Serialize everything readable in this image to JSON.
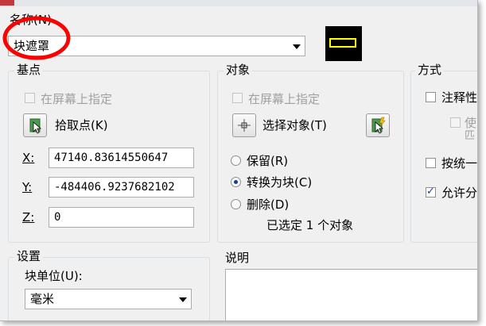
{
  "name_section": {
    "label": "名称(N)",
    "value": "块遮罩"
  },
  "basepoint": {
    "title": "基点",
    "specify_on_screen": "在屏幕上指定",
    "specify_checked": false,
    "pick_point": "拾取点(K)",
    "x_label": "X:",
    "x_value": "47140.83614550647",
    "y_label": "Y:",
    "y_value": "-484406.9237682102",
    "z_label": "Z:",
    "z_value": "0"
  },
  "objects": {
    "title": "对象",
    "specify_on_screen": "在屏幕上指定",
    "select_objects": "选择对象(T)",
    "retain": "保留(R)",
    "convert": "转换为块(C)",
    "delete": "删除(D)",
    "selected_option": "convert",
    "status": "已选定 1 个对象"
  },
  "behavior": {
    "title": "方式",
    "annotative": "注释性",
    "match_orientation_part1": "使",
    "match_orientation_part2": "匹",
    "scale_uniformly": "按统一",
    "allow_exploding": "允许分",
    "allow_exploding_checked": true
  },
  "settings": {
    "title": "设置",
    "block_unit_label": "块单位(U):",
    "block_unit_value": "毫米"
  },
  "description": {
    "title": "说明",
    "value": ""
  },
  "colors": {
    "annotation_circle": "#ff0000",
    "preview_bg": "#000000",
    "preview_rect": "#ffff00"
  }
}
